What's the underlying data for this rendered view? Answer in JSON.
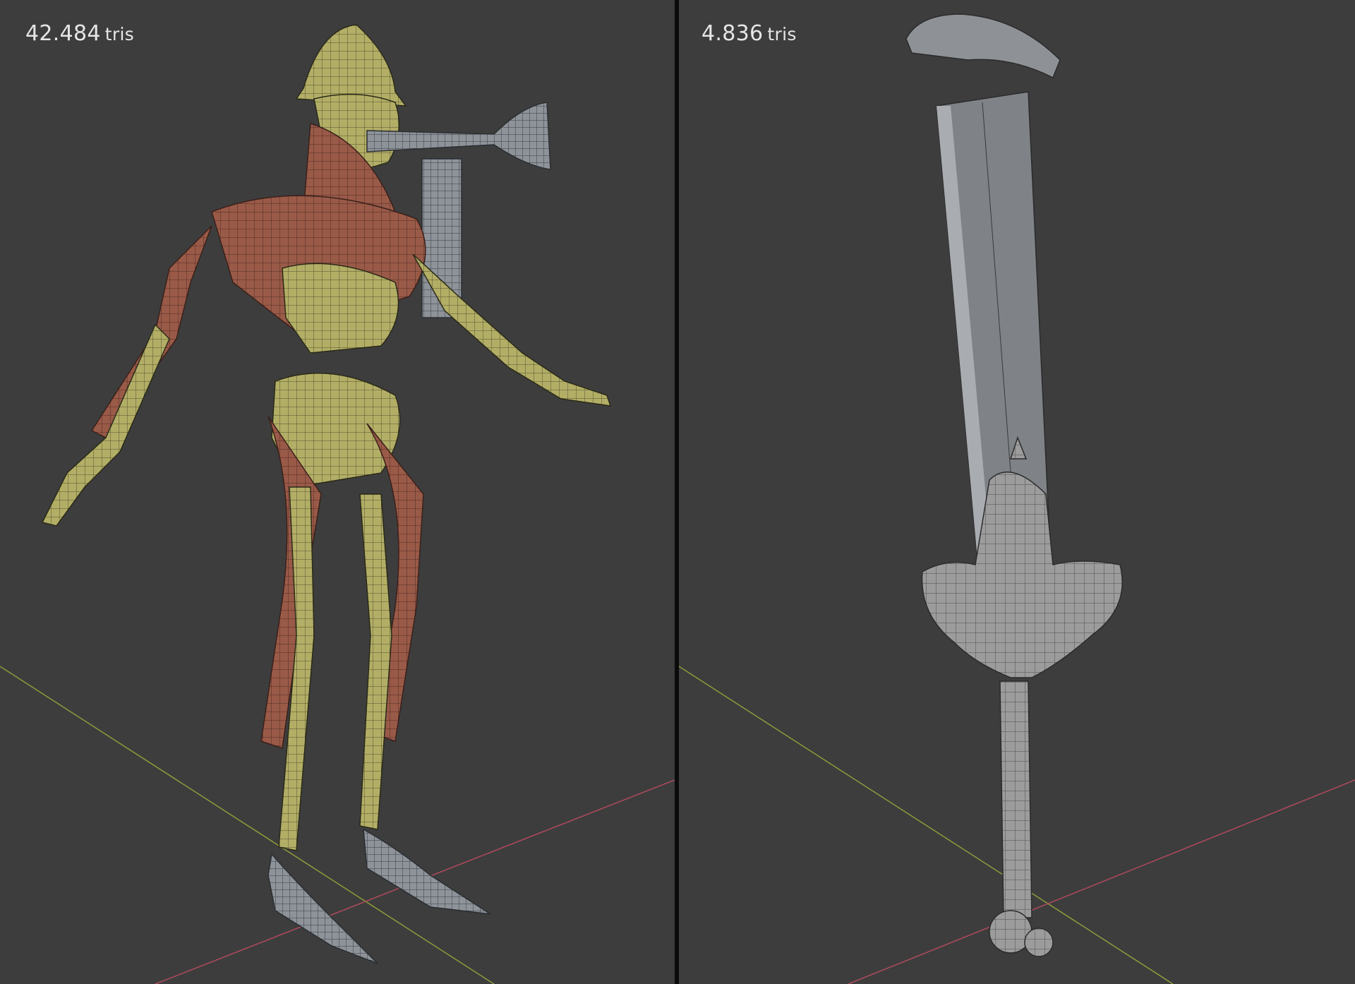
{
  "viewports": [
    {
      "id": "character",
      "stats": {
        "value": "42.484",
        "unit": "tris"
      },
      "object_icon": "skeletal-character-mesh"
    },
    {
      "id": "weapon",
      "stats": {
        "value": "4.836",
        "unit": "tris"
      },
      "object_icon": "greatsword-mesh"
    }
  ],
  "colors": {
    "viewport_bg": "#3d3d3d",
    "divider": "#0b0b0b",
    "overlay_text": "#e6e6e6",
    "axis_x": "#b04a5c",
    "axis_y": "#8f9a3a",
    "bone_color": "#b5b16a",
    "muscle_color": "#9a5a48",
    "metal_color": "#8d9196",
    "sword_color": "#9c9c9c",
    "wire_color": "#2a2a2a"
  }
}
